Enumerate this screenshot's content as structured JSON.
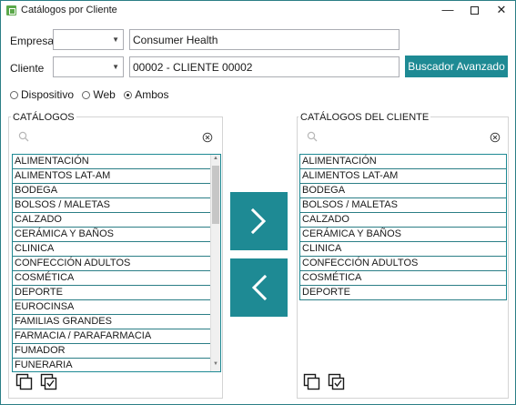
{
  "window": {
    "title": "Catálogos por Cliente",
    "minimize_glyph": "—",
    "close_glyph": "✕"
  },
  "form": {
    "empresa_label": "Empresa",
    "empresa_combo_value": "",
    "empresa_name": "Consumer Health",
    "cliente_label": "Cliente",
    "cliente_combo_value": "",
    "cliente_name": "00002 - CLIENTE 00002",
    "advanced_search_label": "Buscador Avanzado"
  },
  "filter": {
    "options": [
      "Dispositivo",
      "Web",
      "Ambos"
    ],
    "selected": "Ambos"
  },
  "catalogs": {
    "title": "CATÁLOGOS",
    "search_value": "",
    "items": [
      "ALIMENTACIÓN",
      "ALIMENTOS LAT-AM",
      "BODEGA",
      "BOLSOS / MALETAS",
      "CALZADO",
      "CERÁMICA Y BAÑOS",
      "CLINICA",
      "CONFECCIÓN ADULTOS",
      "COSMÉTICA",
      "DEPORTE",
      "EUROCINSA",
      "FAMILIAS GRANDES",
      "FARMACIA / PARAFARMACIA",
      "FUMADOR",
      "FUNERARIA"
    ]
  },
  "client_catalogs": {
    "title": "CATÁLOGOS DEL CLIENTE",
    "search_value": "",
    "items": [
      "ALIMENTACIÓN",
      "ALIMENTOS LAT-AM",
      "BODEGA",
      "BOLSOS / MALETAS",
      "CALZADO",
      "CERÁMICA Y BAÑOS",
      "CLINICA",
      "CONFECCIÓN ADULTOS",
      "COSMÉTICA",
      "DEPORTE"
    ]
  },
  "colors": {
    "accent": "#1e8a94",
    "list_border": "#2b7e86"
  }
}
